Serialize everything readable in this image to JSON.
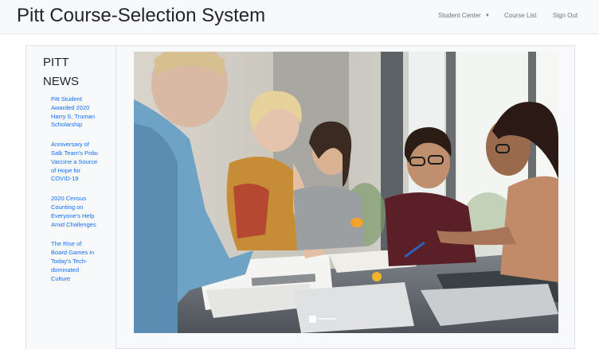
{
  "navbar": {
    "brand": "Pitt Course-Selection System",
    "links": {
      "student_center": "Student Center",
      "course_list": "Course List",
      "sign_out": "Sign Out"
    }
  },
  "sidebar": {
    "title_line1": "PITT",
    "title_line2": "NEWS",
    "news": [
      "Pitt Student Awarded 2020 Harry S. Truman Scholarship",
      "Anniversary of Salk Team's Polio Vaccine a Source of Hope for COVID-19",
      "2020 Census Counting on Everyone's Help Amid Challenges",
      "The Rise of Board Games in Today's Tech-dominated Culture"
    ]
  },
  "colors": {
    "navbar_bg": "#f8f9fa",
    "link": "#0d6efd",
    "muted_nav": "#6c757d"
  },
  "icons": {
    "dropdown": "caret-down-icon"
  }
}
